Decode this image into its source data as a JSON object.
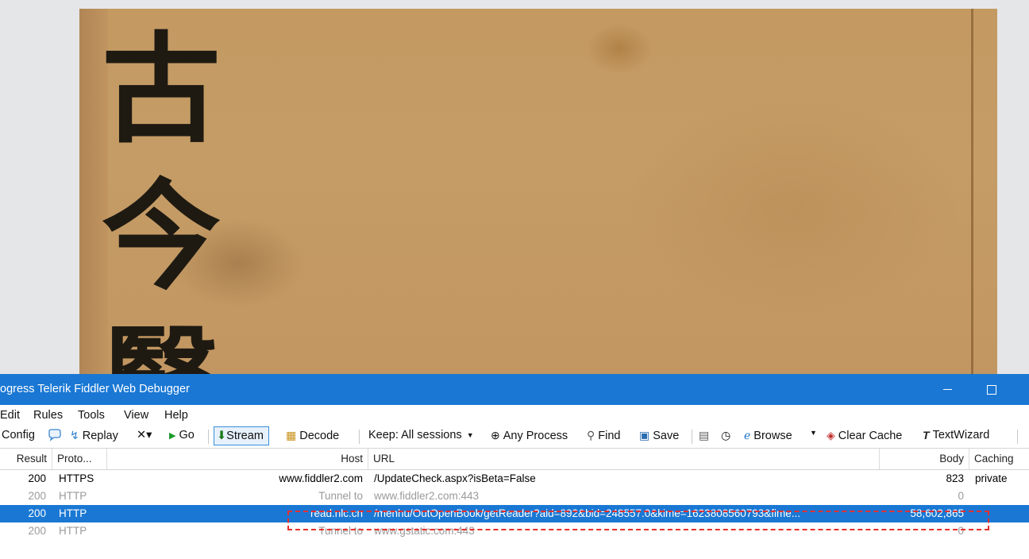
{
  "background_page": {
    "characters": [
      "古",
      "今",
      "醫"
    ]
  },
  "window": {
    "title": "ogress Telerik Fiddler Web Debugger",
    "minimize_glyph": "—",
    "maximize_glyph": "□"
  },
  "menu": [
    "Edit",
    "Rules",
    "Tools",
    "View",
    "Help"
  ],
  "toolbar": {
    "config": "Config",
    "replay": "Replay",
    "remove": "✕▾",
    "go": "Go",
    "stream": "Stream",
    "decode": "Decode",
    "keep": "Keep: All sessions",
    "any_process": "Any Process",
    "find": "Find",
    "save": "Save",
    "browse": "Browse",
    "clear_cache": "Clear Cache",
    "textwizard": "TextWizard"
  },
  "columns": {
    "result": "Result",
    "protocol": "Proto...",
    "host": "Host",
    "url": "URL",
    "body": "Body",
    "caching": "Caching"
  },
  "sessions": [
    {
      "result": "200",
      "protocol": "HTTPS",
      "host": "www.fiddler2.com",
      "url": "/UpdateCheck.aspx?isBeta=False",
      "body": "823",
      "caching": "private",
      "state": "normal"
    },
    {
      "result": "200",
      "protocol": "HTTP",
      "host": "Tunnel to",
      "url": "www.fiddler2.com:443",
      "body": "0",
      "caching": "",
      "state": "dim"
    },
    {
      "result": "200",
      "protocol": "HTTP",
      "host": "read.nlc.cn",
      "url": "/menhu/OutOpenBook/getReader?aid=892&bid=248557.0&kime=1623808560793&fime...",
      "body": "58,602,865",
      "caching": "",
      "state": "selected"
    },
    {
      "result": "200",
      "protocol": "HTTP",
      "host": "Tunnel to",
      "url": "www.gstatic.com:443",
      "body": "0",
      "caching": "",
      "state": "dim"
    }
  ],
  "colors": {
    "titlebar": "#1a78d4",
    "selection": "#1a78d4",
    "highlight_box": "#e53030"
  }
}
